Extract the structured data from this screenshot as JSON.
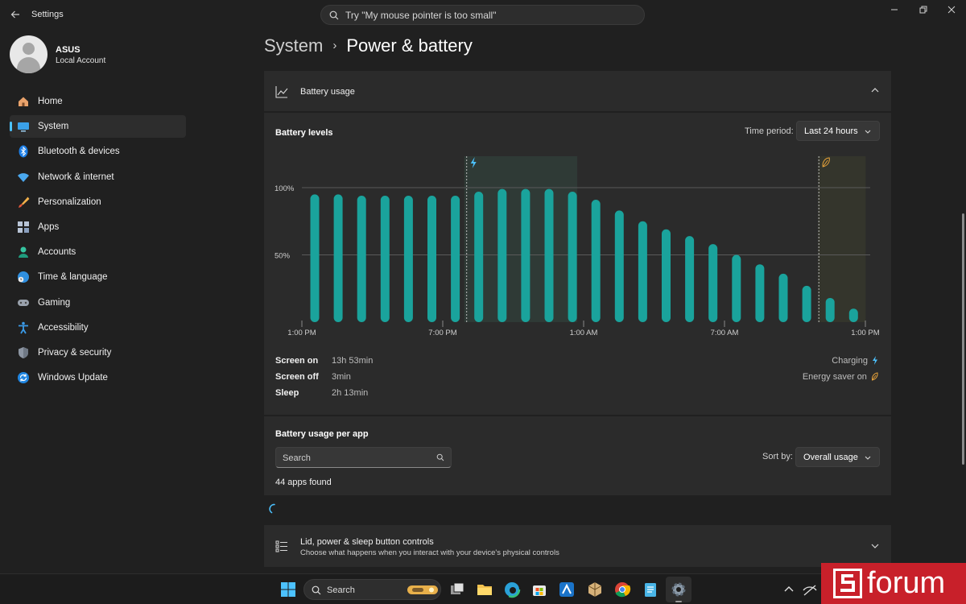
{
  "window": {
    "title": "Settings",
    "search_placeholder": "Try \"My mouse pointer is too small\""
  },
  "profile": {
    "name": "ASUS",
    "account_type": "Local Account"
  },
  "nav": [
    {
      "label": "Home",
      "icon": "home-icon",
      "active": false
    },
    {
      "label": "System",
      "icon": "system-icon",
      "active": true
    },
    {
      "label": "Bluetooth & devices",
      "icon": "bluetooth-icon",
      "active": false
    },
    {
      "label": "Network & internet",
      "icon": "wifi-icon",
      "active": false
    },
    {
      "label": "Personalization",
      "icon": "brush-icon",
      "active": false
    },
    {
      "label": "Apps",
      "icon": "apps-icon",
      "active": false
    },
    {
      "label": "Accounts",
      "icon": "account-icon",
      "active": false
    },
    {
      "label": "Time & language",
      "icon": "globe-clock-icon",
      "active": false
    },
    {
      "label": "Gaming",
      "icon": "gamepad-icon",
      "active": false
    },
    {
      "label": "Accessibility",
      "icon": "accessibility-icon",
      "active": false
    },
    {
      "label": "Privacy & security",
      "icon": "shield-icon",
      "active": false
    },
    {
      "label": "Windows Update",
      "icon": "update-icon",
      "active": false
    }
  ],
  "breadcrumb": {
    "parent": "System",
    "separator": "›",
    "current": "Power & battery"
  },
  "battery_usage": {
    "header": "Battery usage",
    "levels_title": "Battery levels",
    "time_period_label": "Time period:",
    "time_period_value": "Last 24 hours",
    "stats": [
      {
        "name": "Screen on",
        "value": "13h 53min"
      },
      {
        "name": "Screen off",
        "value": "3min"
      },
      {
        "name": "Sleep",
        "value": "2h 13min"
      }
    ],
    "legend": {
      "charging": "Charging",
      "energy_saver": "Energy saver on"
    }
  },
  "chart_data": {
    "type": "bar",
    "y_ticks": [
      "100%",
      "50%"
    ],
    "x_ticks": [
      "1:00 PM",
      "7:00 PM",
      "1:00 AM",
      "7:00 AM",
      "1:00 PM"
    ],
    "ylim": [
      0,
      100
    ],
    "values": [
      95,
      95,
      94,
      94,
      94,
      94,
      94,
      97,
      99,
      99,
      99,
      97,
      91,
      83,
      75,
      69,
      64,
      58,
      50,
      43,
      36,
      27,
      18,
      10
    ],
    "charging_band": {
      "start_index": 7,
      "end_index": 11
    },
    "energy_saver_band": {
      "start_index": 22,
      "end_index": 23
    },
    "bar_color": "#1aa39c",
    "charging_color": "#4cc2ff",
    "energy_saver_color": "#e8a33a"
  },
  "apps_section": {
    "title": "Battery usage per app",
    "search_placeholder": "Search",
    "sort_label": "Sort by:",
    "sort_value": "Overall usage",
    "count_text": "44 apps found"
  },
  "lid_section": {
    "title": "Lid, power & sleep button controls",
    "subtitle": "Choose what happens when you interact with your device's physical controls"
  },
  "taskbar": {
    "search_label": "Search"
  },
  "watermark": {
    "text": "forum"
  }
}
